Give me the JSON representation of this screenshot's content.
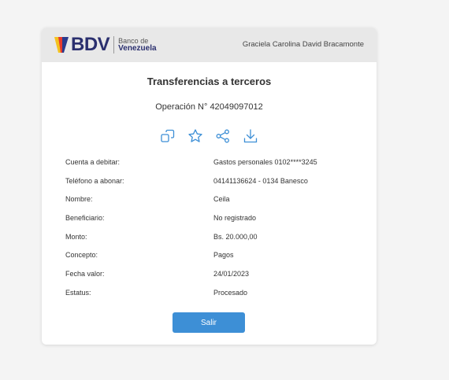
{
  "header": {
    "brand": "BDV",
    "brand_sub_line1": "Banco de",
    "brand_sub_line2": "Venezuela",
    "user_name": "Graciela Carolina David Bracamonte"
  },
  "main": {
    "title": "Transferencias a terceros",
    "operation": "Operación N° 42049097012",
    "actions": [
      "copy-icon",
      "star-icon",
      "share-icon",
      "download-icon"
    ],
    "details": [
      {
        "label": "Cuenta a debitar:",
        "value": "Gastos personales 0102****3245"
      },
      {
        "label": "Teléfono a abonar:",
        "value": "04141136624 - 0134 Banesco"
      },
      {
        "label": "Nombre:",
        "value": "Ceila"
      },
      {
        "label": "Beneficiario:",
        "value": "No registrado"
      },
      {
        "label": "Monto:",
        "value": "Bs. 20.000,00"
      },
      {
        "label": "Concepto:",
        "value": "Pagos"
      },
      {
        "label": "Fecha valor:",
        "value": "24/01/2023"
      },
      {
        "label": "Estatus:",
        "value": "Procesado"
      }
    ],
    "exit_label": "Salir"
  },
  "colors": {
    "accent": "#3d8fd6",
    "brand_navy": "#2a2f6e",
    "header_bg": "#e8e8e8"
  }
}
